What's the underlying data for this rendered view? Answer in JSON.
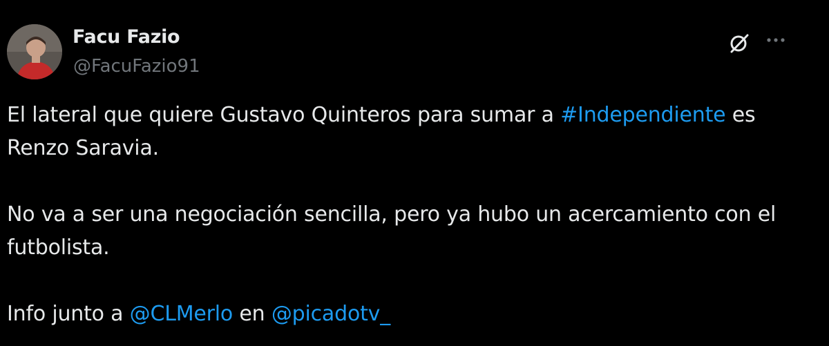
{
  "author": {
    "name": "Facu Fazio",
    "handle": "@FacuFazio91",
    "avatar_icon": "user-avatar"
  },
  "actions": {
    "grok_icon": "grok-icon",
    "more_icon": "more-options-icon"
  },
  "tweet": {
    "p1": {
      "text_before": "El lateral que quiere Gustavo Quinteros para sumar a ",
      "hashtag": "#Independiente",
      "text_after": " es Renzo Saravia."
    },
    "p2": {
      "text": "No va a ser una negociación sencilla, pero ya hubo un acercamiento con el futbolista."
    },
    "p3": {
      "text_before": "Info junto a ",
      "mention1": "@CLMerlo",
      "text_middle": " en ",
      "mention2": "@picadotv_"
    }
  },
  "colors": {
    "background": "#000000",
    "text": "#e7e9ea",
    "secondary_text": "#71767b",
    "link": "#1d9bf0"
  }
}
